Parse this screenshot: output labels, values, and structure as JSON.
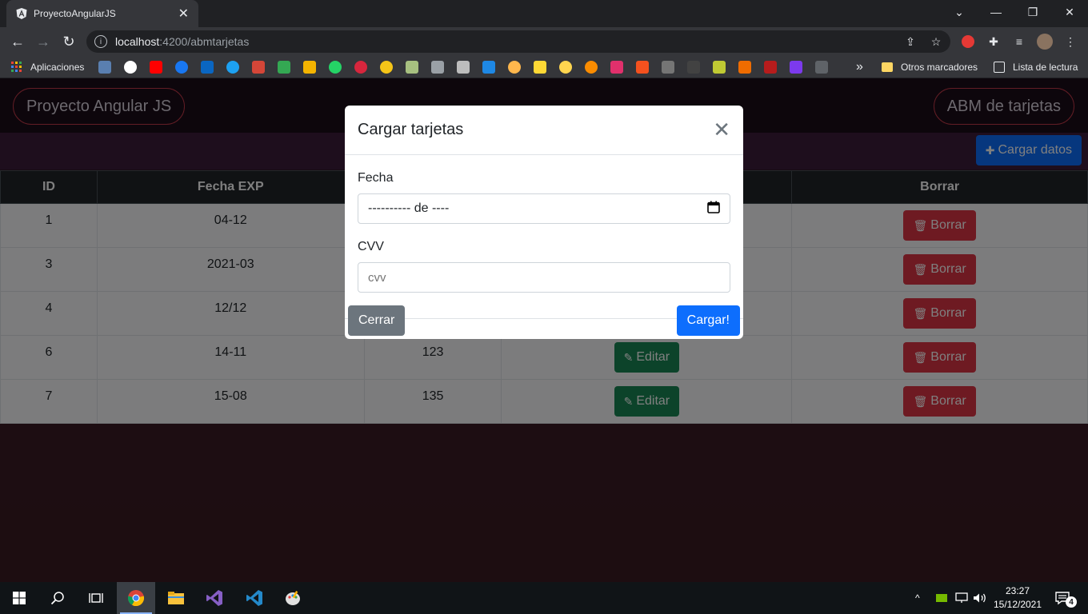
{
  "browser": {
    "tab_title": "ProyectoAngularJS",
    "tab_close": "✕",
    "url_host": "localhost",
    "url_path": ":4200/abmtarjetas",
    "bookmarks_apps_label": "Aplicaciones",
    "bookmarks_more": "»",
    "bookmarks_folder_label": "Otros marcadores",
    "reading_list_label": "Lista de lectura"
  },
  "app": {
    "brand": "Proyecto Angular JS",
    "nav_right": "ABM de tarjetas",
    "cargar_datos_label": "Cargar datos"
  },
  "table": {
    "headers": [
      "ID",
      "Fecha EXP",
      "",
      "",
      "Borrar"
    ],
    "edit_label": "Editar",
    "delete_label": "Borrar",
    "rows": [
      {
        "id": "1",
        "fecha": "04-12",
        "cvv": ""
      },
      {
        "id": "3",
        "fecha": "2021-03",
        "cvv": ""
      },
      {
        "id": "4",
        "fecha": "12/12",
        "cvv": ""
      },
      {
        "id": "6",
        "fecha": "14-11",
        "cvv": "123"
      },
      {
        "id": "7",
        "fecha": "15-08",
        "cvv": "135"
      }
    ]
  },
  "modal": {
    "title": "Cargar tarjetas",
    "fecha_label": "Fecha",
    "fecha_placeholder": "---------- de ----",
    "cvv_label": "CVV",
    "cvv_placeholder": "cvv",
    "close_label": "Cerrar",
    "submit_label": "Cargar!"
  },
  "taskbar": {
    "time": "23:27",
    "date": "15/12/2021",
    "notifications_count": "4"
  },
  "colors": {
    "primary": "#0d6efd",
    "success": "#198754",
    "danger": "#dc3545",
    "secondary": "#6c757d"
  }
}
